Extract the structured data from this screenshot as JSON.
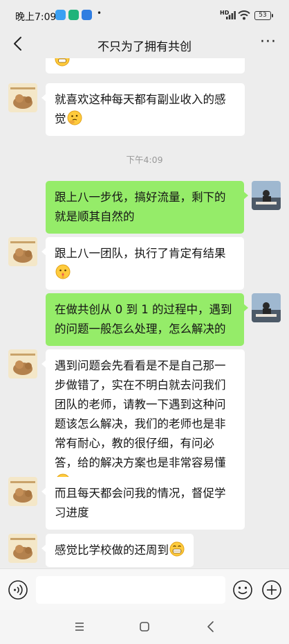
{
  "status_bar": {
    "time": "晚上7:09",
    "network": "HD",
    "battery": "53"
  },
  "header": {
    "title": "不只为了拥有共创"
  },
  "chat": {
    "timestamp": "下午4:09",
    "messages": [
      {
        "side": "in",
        "text": "就喜欢这种每天都有副业收入的感觉",
        "emoji": "thinking-face"
      },
      {
        "side": "out",
        "text": "跟上八一步伐，搞好流量，剩下的就是顺其自然的"
      },
      {
        "side": "in",
        "text": "跟上八一团队，执行了肯定有结果",
        "emoji": "shushing-face"
      },
      {
        "side": "out",
        "text": "在做共创从 0 到 1 的过程中，遇到的问题一般怎么处理，怎么解决的"
      },
      {
        "side": "in",
        "text": "遇到问题会先看看是不是自己那一步做错了，实在不明白就去问我们团队的老师，请教一下遇到这种问题该怎么解决，我们的老师也是非常有耐心，教的很仔细，有问必答，给的解决方案也是非常容易懂",
        "emoji": "thinking-face"
      },
      {
        "side": "in",
        "text": "而且每天都会问我的情况，督促学习进度"
      },
      {
        "side": "in",
        "text": "感觉比学校做的还周到",
        "emoji": "grinning-face"
      }
    ]
  },
  "colors": {
    "background": "#ededed",
    "outgoing_bubble": "#95ec69",
    "incoming_bubble": "#ffffff"
  }
}
